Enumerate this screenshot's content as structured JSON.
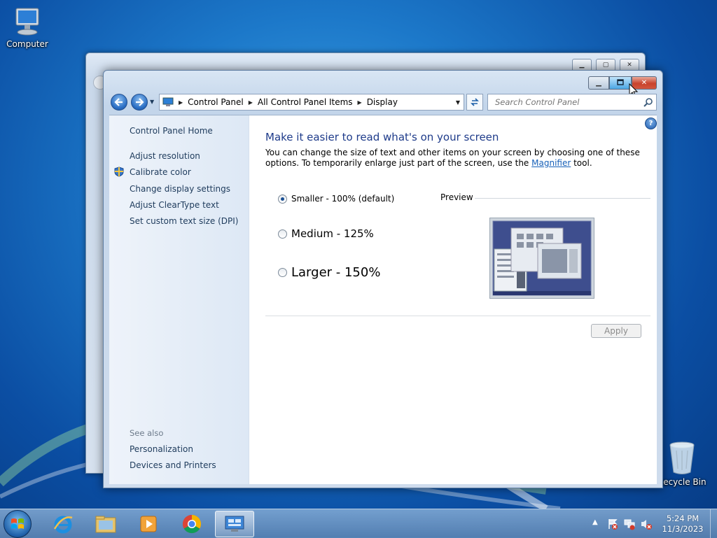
{
  "desktop": {
    "icons": [
      {
        "label": "Computer"
      },
      {
        "label": "Recycle Bin"
      }
    ]
  },
  "window": {
    "caption_buttons": {
      "minimize": "minimize",
      "maximize": "restore",
      "close": "close"
    },
    "breadcrumbs": [
      "Control Panel",
      "All Control Panel Items",
      "Display"
    ],
    "search_placeholder": "Search Control Panel"
  },
  "sidebar": {
    "home": "Control Panel Home",
    "links": [
      {
        "label": "Adjust resolution",
        "icon": null
      },
      {
        "label": "Calibrate color",
        "icon": "shield-icon"
      },
      {
        "label": "Change display settings",
        "icon": null
      },
      {
        "label": "Adjust ClearType text",
        "icon": null
      },
      {
        "label": "Set custom text size (DPI)",
        "icon": null
      }
    ],
    "see_also_title": "See also",
    "see_also": [
      "Personalization",
      "Devices and Printers"
    ]
  },
  "main": {
    "title": "Make it easier to read what's on your screen",
    "description_before": "You can change the size of text and other items on your screen by choosing one of these options. To temporarily enlarge just part of the screen, use the ",
    "description_link": "Magnifier",
    "description_after": " tool.",
    "options": [
      {
        "label": "Smaller - 100% (default)",
        "selected": true
      },
      {
        "label": "Medium - 125%",
        "selected": false
      },
      {
        "label": "Larger - 150%",
        "selected": false
      }
    ],
    "preview_label": "Preview",
    "apply_label": "Apply"
  },
  "taskbar": {
    "apps": [
      "internet-explorer",
      "windows-explorer",
      "media-player",
      "chrome",
      "control-panel"
    ],
    "time": "5:24 PM",
    "date": "11/3/2023"
  },
  "colors": {
    "accent": "#1e3b8a",
    "link": "#1760b8",
    "close_red": "#c8422c"
  }
}
